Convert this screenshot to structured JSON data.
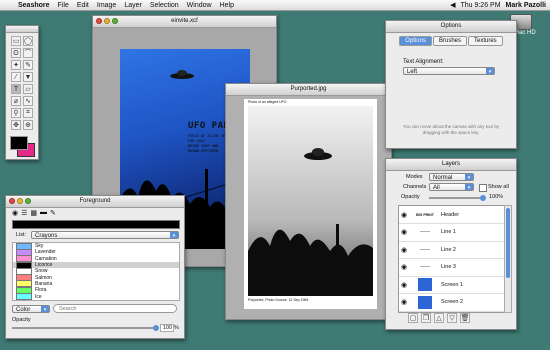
{
  "menubar": {
    "app": "Seashore",
    "items": [
      "File",
      "Edit",
      "Image",
      "Layer",
      "Selection",
      "Window",
      "Help"
    ],
    "clock": "Thu 9:26 PM",
    "user": "Mark Pazolli"
  },
  "desktop": {
    "disk_label": "Mac HD"
  },
  "main_window": {
    "title": "einvite.xcf",
    "poster_title": "UFO PARTY",
    "poster_lines": [
      "PIECE OF ALIEN SPACECRAFT",
      "FOR SALE",
      "BRING YOUR OWN",
      "HUMAN SPECIMEN"
    ]
  },
  "photo_window": {
    "title": "Purported.jpg",
    "caption_top": "Photo of an alleged UFO",
    "caption_bottom": "Purported, Photo Source: 12 Sep 1965"
  },
  "options": {
    "title": "Options",
    "tabs": [
      "Options",
      "Brushes",
      "Textures"
    ],
    "label": "Text Alignment:",
    "alignment": "Left",
    "hint": "You can move about the canvas with any tool by dragging with the space key."
  },
  "layers": {
    "title": "Layers",
    "modes_label": "Modes",
    "mode": "Normal",
    "channels_label": "Channels",
    "channels": "All",
    "show_all": "Show all",
    "opacity_label": "Opacity",
    "opacity": "100%",
    "items": [
      {
        "thumb": "BIG PRINT",
        "name": "Header"
      },
      {
        "thumb": "~~~~~",
        "name": "Line 1"
      },
      {
        "thumb": "~~~~~",
        "name": "Line 2"
      },
      {
        "thumb": "~~~~~",
        "name": "Line 3"
      },
      {
        "thumb": "",
        "name": "Screen 1"
      },
      {
        "thumb": "",
        "name": "Screen 2"
      }
    ]
  },
  "foreground": {
    "title": "Foreground",
    "list_label": "List:",
    "list_value": "Crayons",
    "colors": [
      {
        "name": "Sky",
        "color": "#6fb7ff"
      },
      {
        "name": "Lavender",
        "color": "#c58bff"
      },
      {
        "name": "Carnation",
        "color": "#ff8fd0"
      },
      {
        "name": "Licorice",
        "color": "#000000"
      },
      {
        "name": "Snow",
        "color": "#ffffff"
      },
      {
        "name": "Salmon",
        "color": "#ff7f7f"
      },
      {
        "name": "Banana",
        "color": "#ffff66"
      },
      {
        "name": "Flora",
        "color": "#66ff66"
      },
      {
        "name": "Ice",
        "color": "#66ffff"
      }
    ],
    "selected_index": 3,
    "mode": "Color",
    "search_placeholder": "Search",
    "opacity_label": "Opacity",
    "opacity": "100",
    "opacity_unit": "%"
  },
  "colors": {
    "foreground_swatch": "#000000",
    "background_swatch": "#e62a8a"
  }
}
